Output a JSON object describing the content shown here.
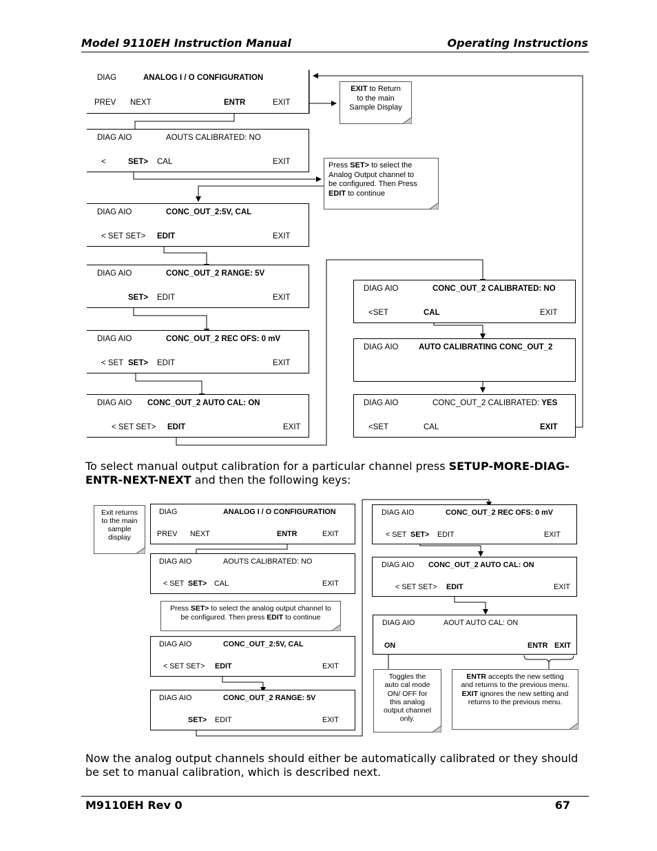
{
  "header": {
    "left": "Model 9110EH Instruction Manual",
    "right": "Operating Instructions"
  },
  "footer": {
    "left": "M9110EH Rev 0",
    "right": "67"
  },
  "diagram1": {
    "screens": [
      {
        "top_left": "DIAG",
        "top_right": "ANALOG I / O CONFIGURATION",
        "keys": [
          "PREV",
          "NEXT",
          "ENTR",
          "EXIT"
        ]
      },
      {
        "top_left": "DIAG AIO",
        "top_right": "AOUTS CALIBRATED: NO",
        "keys": [
          "<",
          "SET>",
          "CAL",
          "EXIT"
        ]
      },
      {
        "top_left": "DIAG AIO",
        "top_right": "CONC_OUT_2:5V, CAL",
        "keys": [
          "< SET  SET>",
          "EDIT",
          "EXIT"
        ]
      },
      {
        "top_left": "DIAG AIO",
        "top_right": "CONC_OUT_2 RANGE: 5V",
        "keys": [
          "SET>",
          "EDIT",
          "EXIT"
        ]
      },
      {
        "top_left": "DIAG AIO",
        "top_right": "CONC_OUT_2 REC OFS: 0 mV",
        "keys": [
          "< SET",
          "SET>",
          "EDIT",
          "EXIT"
        ]
      },
      {
        "top_left": "DIAG AIO",
        "top_right": "CONC_OUT_2 AUTO CAL: ON",
        "keys": [
          "< SET  SET>",
          "EDIT",
          "EXIT"
        ]
      },
      {
        "top_left": "DIAG AIO",
        "top_right": "CONC_OUT_2 CALIBRATED:  NO",
        "keys": [
          "<SET",
          "CAL",
          "EXIT"
        ]
      },
      {
        "top_left": "DIAG AIO",
        "top_right": "AUTO CALIBRATING CONC_OUT_2",
        "keys": []
      },
      {
        "top_left": "DIAG AIO",
        "top_right_a": "CONC_OUT_2 CALIBRATED: ",
        "top_right_b": "YES",
        "keys": [
          "<SET",
          "CAL",
          "EXIT"
        ]
      }
    ],
    "notes": {
      "exit": {
        "b1": "EXIT",
        "t1": " to Return",
        "t2": "to the main",
        "t3": "Sample Display"
      },
      "set": {
        "t0": "Press ",
        "b1": "SET>",
        "t1": " to select the",
        "t2": "Analog Output channel to",
        "t3": "be configured. Then Press",
        "b2": "EDIT",
        "t4": " to continue"
      }
    }
  },
  "paragraph1": {
    "t1": "To select manual output calibration for a particular channel press ",
    "b1": "SETUP-MORE-DIAG-",
    "b2": "ENTR-NEXT-NEXT",
    "t2": " and then the following keys:"
  },
  "diagram2": {
    "screens": [
      {
        "top_left": "DIAG",
        "top_right": "ANALOG I / O CONFIGURATION",
        "keys": [
          "PREV",
          "NEXT",
          "ENTR",
          "EXIT"
        ]
      },
      {
        "top_left": "DIAG AIO",
        "top_right": "AOUTS CALIBRATED: NO",
        "keys": [
          "< SET",
          "SET>",
          "CAL",
          "EXIT"
        ]
      },
      {
        "top_left": "DIAG AIO",
        "top_right": "CONC_OUT_2:5V, CAL",
        "keys": [
          "< SET  SET>",
          "EDIT",
          "EXIT"
        ]
      },
      {
        "top_left": "DIAG AIO",
        "top_right": "CONC_OUT_2 RANGE: 5V",
        "keys": [
          "SET>",
          "EDIT",
          "EXIT"
        ]
      },
      {
        "top_left": "DIAG AIO",
        "top_right": "CONC_OUT_2 REC OFS: 0 mV",
        "keys": [
          "< SET",
          "SET>",
          "EDIT",
          "EXIT"
        ]
      },
      {
        "top_left": "DIAG AIO",
        "top_right": "CONC_OUT_2 AUTO CAL: ON",
        "keys": [
          "< SET  SET>",
          "EDIT",
          "EXIT"
        ]
      },
      {
        "top_left": "DIAG AIO",
        "top_right": "AOUT AUTO CAL: ON",
        "keys": [
          "ON",
          "ENTR",
          "EXIT"
        ]
      }
    ],
    "notes": {
      "exit": {
        "t1": "Exit returns",
        "t2": "to the main",
        "t3": "sample",
        "t4": "display"
      },
      "set": {
        "t0": "Press ",
        "b1": "SET>",
        "t1": " to select the analog output channel to",
        "t2": "be configured. Then press ",
        "b2": "EDIT",
        "t3": " to continue"
      },
      "toggle": {
        "t1": "Toggles the",
        "t2": "auto cal mode",
        "t3": "ON/ OFF for",
        "t4": "this analog",
        "t5": "output channel",
        "t6": "only."
      },
      "entr": {
        "b1": "ENTR",
        "t1": " accepts the new setting",
        "t2": "and returns to the previous menu.",
        "b2": "EXIT",
        "t3": " ignores the new setting and",
        "t4": "returns to the previous menu."
      }
    }
  },
  "paragraph2": {
    "t1": "Now the analog output channels should either be automatically calibrated or they should be set to manual calibration, which is described next."
  }
}
